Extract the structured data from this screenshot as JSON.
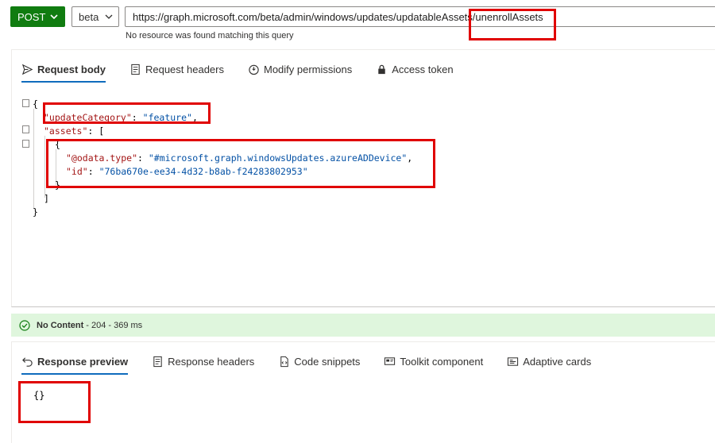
{
  "request": {
    "method": "POST",
    "version": "beta",
    "url": "https://graph.microsoft.com/beta/admin/windows/updates/updatableAssets/unenrollAssets",
    "url_error": "No resource was found matching this query"
  },
  "request_tabs": [
    {
      "label": "Request body",
      "icon": "send-icon",
      "active": true
    },
    {
      "label": "Request headers",
      "icon": "document-icon",
      "active": false
    },
    {
      "label": "Modify permissions",
      "icon": "shield-icon",
      "active": false
    },
    {
      "label": "Access token",
      "icon": "lock-icon",
      "active": false
    }
  ],
  "request_body": {
    "open_brace": "{",
    "update_category_key": "\"updateCategory\"",
    "update_category_value": "\"feature\"",
    "assets_key": "\"assets\"",
    "open_bracket": "[",
    "item_open": "{",
    "odata_type_key": "\"@odata.type\"",
    "odata_type_value": "\"#microsoft.graph.windowsUpdates.azureADDevice\"",
    "id_key": "\"id\"",
    "id_value": "\"76ba670e-ee34-4d32-b8ab-f24283802953\"",
    "item_close": "}",
    "close_bracket": "]",
    "close_brace": "}"
  },
  "status": {
    "label": "No Content",
    "detail": "- 204 - 369 ms",
    "color": "#107c10"
  },
  "response_tabs": [
    {
      "label": "Response preview",
      "icon": "undo-icon",
      "active": true
    },
    {
      "label": "Response headers",
      "icon": "document-icon",
      "active": false
    },
    {
      "label": "Code snippets",
      "icon": "code-file-icon",
      "active": false
    },
    {
      "label": "Toolkit component",
      "icon": "toolkit-icon",
      "active": false
    },
    {
      "label": "Adaptive cards",
      "icon": "card-icon",
      "active": false
    }
  ],
  "response_body": "{}",
  "colors": {
    "accent": "#0f6cbd",
    "method": "#107c10",
    "highlight": "#e00000",
    "success_bg": "#dff6dd"
  }
}
